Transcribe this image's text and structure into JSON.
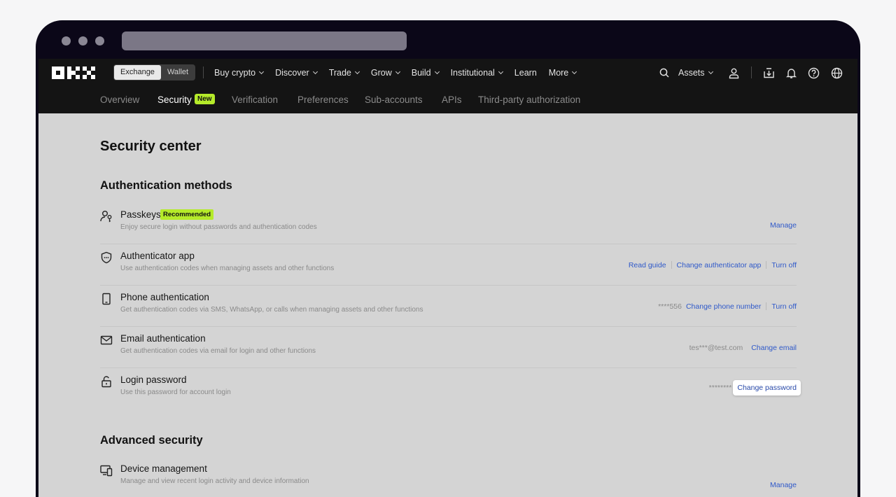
{
  "browser": {
    "url": ""
  },
  "topnav": {
    "toggle": [
      "Exchange",
      "Wallet"
    ],
    "menu": [
      "Buy crypto",
      "Discover",
      "Trade",
      "Grow",
      "Build",
      "Institutional",
      "Learn",
      "More"
    ],
    "menu_has_chevron": [
      true,
      true,
      true,
      true,
      true,
      true,
      false,
      true
    ],
    "assets_label": "Assets"
  },
  "subnav": {
    "tabs": [
      "Overview",
      "Security",
      "Verification",
      "Preferences",
      "Sub-accounts",
      "APIs",
      "Third-party authorization"
    ],
    "active_tab": "Security",
    "new_badge": "New"
  },
  "page": {
    "title": "Security center",
    "auth_heading": "Authentication methods",
    "advanced_heading": "Advanced security"
  },
  "auth_methods": [
    {
      "icon": "passkey-icon",
      "title": "Passkeys",
      "badge": "Recommended",
      "desc": "Enjoy secure login without passwords and authentication codes",
      "value": "",
      "actions": [
        "Manage"
      ]
    },
    {
      "icon": "shield-icon",
      "title": "Authenticator app",
      "desc": "Use authentication codes when managing assets and other functions",
      "value": "",
      "actions": [
        "Read guide",
        "Change authenticator app",
        "Turn off"
      ]
    },
    {
      "icon": "phone-icon",
      "title": "Phone authentication",
      "desc": "Get authentication codes via SMS, WhatsApp, or calls when managing assets and other functions",
      "value": "****556",
      "actions": [
        "Change phone number",
        "Turn off"
      ]
    },
    {
      "icon": "mail-icon",
      "title": "Email authentication",
      "desc": "Get authentication codes via email for login and other functions",
      "value": "tes***@test.com",
      "actions": [
        "Change email"
      ]
    },
    {
      "icon": "lock-icon",
      "title": "Login password",
      "desc": "Use this password for account login",
      "value": "********",
      "actions": [
        "Change password"
      ]
    }
  ],
  "advanced": [
    {
      "icon": "devices-icon",
      "title": "Device management",
      "desc": "Manage and view recent login activity and device information",
      "actions": [
        "Manage"
      ]
    }
  ],
  "colors": {
    "accent_green": "#b5eb2a",
    "link_blue": "#2f59c9",
    "nav_bg": "#141414",
    "content_bg": "#d4d4d4"
  }
}
